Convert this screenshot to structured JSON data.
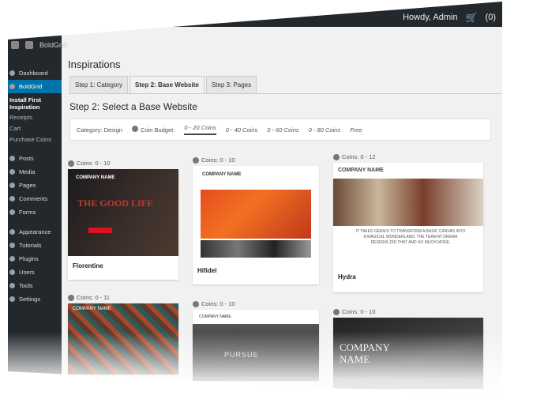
{
  "topbar": {
    "site_name": "BoldGrid",
    "greeting": "Howdy, Admin",
    "cart_label": "(0)"
  },
  "sidebar": {
    "items": [
      {
        "label": "Dashboard"
      },
      {
        "label": "BoldGrid",
        "active": true
      },
      {
        "label": "Install First Inspiration",
        "sub": true
      },
      {
        "label": "Receipts",
        "subitem": true
      },
      {
        "label": "Cart",
        "subitem": true
      },
      {
        "label": "Purchase Coins",
        "subitem": true
      },
      {
        "label": "Posts"
      },
      {
        "label": "Media"
      },
      {
        "label": "Pages"
      },
      {
        "label": "Comments"
      },
      {
        "label": "Forms"
      },
      {
        "label": "Appearance"
      },
      {
        "label": "Tutorials"
      },
      {
        "label": "Plugins"
      },
      {
        "label": "Users"
      },
      {
        "label": "Tools"
      },
      {
        "label": "Settings"
      }
    ]
  },
  "page": {
    "title": "Inspirations",
    "tabs": [
      "Step 1: Category",
      "Step 2: Base Website",
      "Step 3: Pages"
    ],
    "heading": "Step 2: Select a Base Website",
    "filter": {
      "category": "Category: Design",
      "budget_label": "Coin Budget:",
      "options": [
        "0 - 20 Coins",
        "0 - 40 Coins",
        "0 - 60 Coins",
        "0 - 80 Coins",
        "Free"
      ]
    }
  },
  "cards": [
    {
      "coins": "Coins: 0 - 10",
      "name": "Florentine",
      "thumb_text": "THE GOOD LIFE",
      "logo": "COMPANY NAME"
    },
    {
      "coins": "Coins: 0 - 10",
      "name": "Hifidel",
      "thumb_text": "",
      "logo": "COMPANY NAME"
    },
    {
      "coins": "Coins: 0 - 12",
      "name": "Hydra",
      "thumb_text": "IT TAKES GENIUS TO TRANSFORM A BASIC CANVAS INTO A MAGICAL WONDERLAND. THE TEAM AT DREAM DESIGNS DID THAT AND SO MUCH MORE.",
      "logo": "COMPANY NAME"
    },
    {
      "coins": "Coins: 0 - 11",
      "name": "",
      "thumb_text": "",
      "logo": "COMPANY NAME"
    },
    {
      "coins": "Coins: 0 - 10",
      "name": "",
      "thumb_text": "PURSUE",
      "logo": "COMPANY NAME"
    },
    {
      "coins": "Coins: 0 - 10",
      "name": "",
      "thumb_text": "",
      "logo": "COMPANY NAME"
    }
  ]
}
